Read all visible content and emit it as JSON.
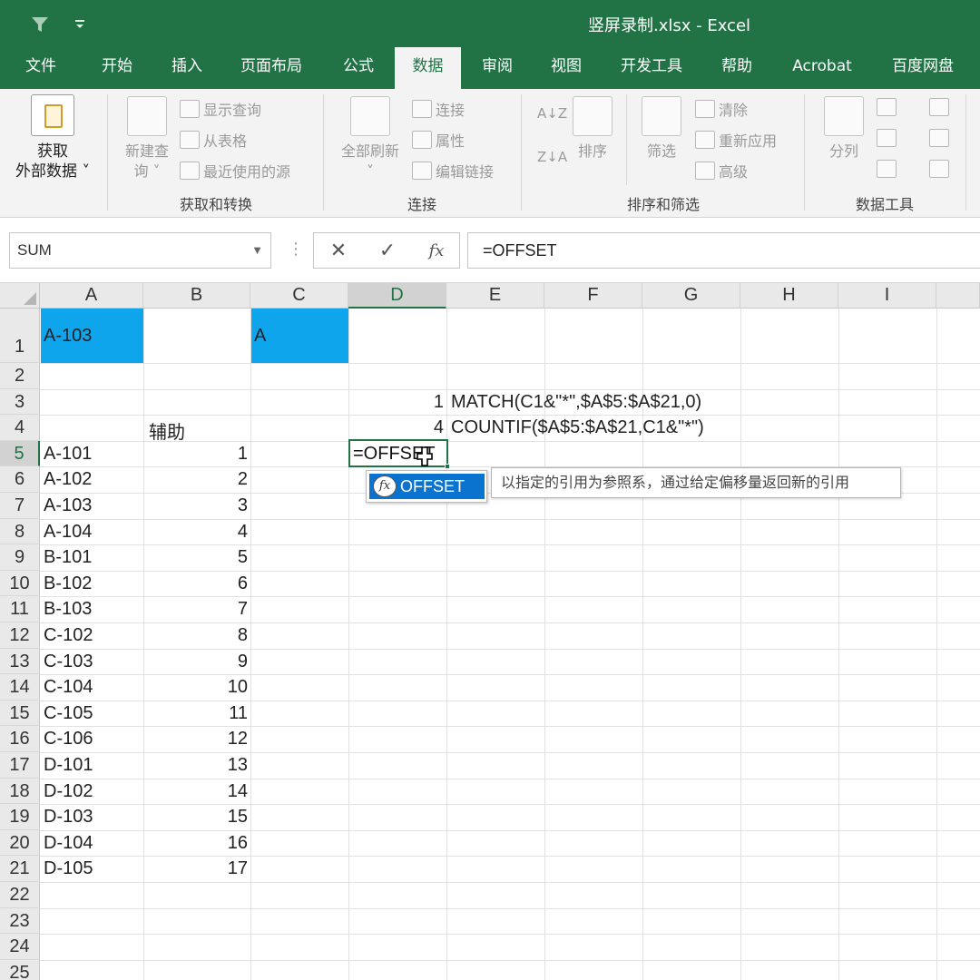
{
  "window": {
    "title": "竖屏录制.xlsx  -  Excel",
    "qat_icons": [
      "funnel-icon",
      "customize-qat-icon"
    ]
  },
  "tabs": [
    {
      "label": "文件",
      "active": false
    },
    {
      "label": "开始",
      "active": false
    },
    {
      "label": "插入",
      "active": false
    },
    {
      "label": "页面布局",
      "active": false
    },
    {
      "label": "公式",
      "active": false
    },
    {
      "label": "数据",
      "active": true
    },
    {
      "label": "审阅",
      "active": false
    },
    {
      "label": "视图",
      "active": false
    },
    {
      "label": "开发工具",
      "active": false
    },
    {
      "label": "帮助",
      "active": false
    },
    {
      "label": "Acrobat",
      "active": false
    },
    {
      "label": "百度网盘",
      "active": false
    }
  ],
  "ribbon": {
    "get_external": {
      "line1": "获取",
      "line2": "外部数据 ˅"
    },
    "get_transform": {
      "new_query_line1": "新建查",
      "new_query_line2": "询 ˅",
      "show_queries": "显示查询",
      "from_table": "从表格",
      "recent_sources": "最近使用的源",
      "label": "获取和转换"
    },
    "connections": {
      "refresh_all_line1": "全部刷新",
      "refresh_all_line2": "˅",
      "connections": "连接",
      "properties": "属性",
      "edit_links": "编辑链接",
      "label": "连接"
    },
    "sort_filter": {
      "sort": "排序",
      "filter": "筛选",
      "clear": "清除",
      "reapply": "重新应用",
      "advanced": "高级",
      "label": "排序和筛选"
    },
    "data_tools": {
      "split": "分列",
      "label": "数据工具"
    }
  },
  "formula_bar": {
    "name_box": "SUM",
    "cancel_symbol": "✕",
    "enter_symbol": "✓",
    "fx_symbol": "fx",
    "formula": "=OFFSET"
  },
  "grid": {
    "columns": [
      "A",
      "B",
      "C",
      "D",
      "E",
      "F",
      "G",
      "H",
      "I"
    ],
    "selected_column": "D",
    "rows": [
      "1",
      "2",
      "3",
      "4",
      "5",
      "6",
      "7",
      "8",
      "9",
      "10",
      "11",
      "12",
      "13",
      "14",
      "15",
      "16",
      "17",
      "18",
      "19",
      "20",
      "21",
      "22",
      "23",
      "24",
      "25"
    ],
    "selected_row": "5",
    "A1": "A-103",
    "C1": "A",
    "D3": "1",
    "E3": "MATCH(C1&\"*\",$A$5:$A$21,0)",
    "D4": "4",
    "E4": "COUNTIF($A$5:$A$21,C1&\"*\")",
    "B4": "辅助",
    "list_a": [
      "A-101",
      "A-102",
      "A-103",
      "A-104",
      "B-101",
      "B-102",
      "B-103",
      "C-102",
      "C-103",
      "C-104",
      "C-105",
      "C-106",
      "D-101",
      "D-102",
      "D-103",
      "D-104",
      "D-105"
    ],
    "list_b": [
      "1",
      "2",
      "3",
      "4",
      "5",
      "6",
      "7",
      "8",
      "9",
      "10",
      "11",
      "12",
      "13",
      "14",
      "15",
      "16",
      "17"
    ],
    "editing_text": "=OFFSET",
    "fill_color": "#0ea5ec"
  },
  "autocomplete": {
    "item": "OFFSET",
    "icon_text": "fx",
    "tooltip": "以指定的引用为参照系，通过给定偏移量返回新的引用"
  }
}
